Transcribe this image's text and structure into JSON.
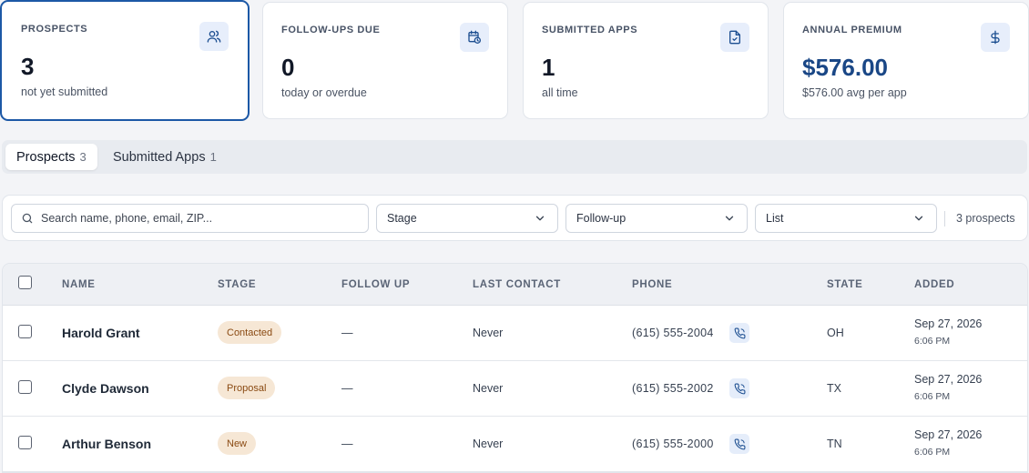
{
  "stats": [
    {
      "label": "PROSPECTS",
      "value": "3",
      "sub": "not yet submitted",
      "icon": "users-icon"
    },
    {
      "label": "FOLLOW-UPS DUE",
      "value": "0",
      "sub": "today or overdue",
      "icon": "calendar-clock-icon"
    },
    {
      "label": "SUBMITTED APPS",
      "value": "1",
      "sub": "all time",
      "icon": "file-check-icon"
    },
    {
      "label": "ANNUAL PREMIUM",
      "value": "$576.00",
      "sub": "$576.00 avg per app",
      "icon": "dollar-icon"
    }
  ],
  "tabs": [
    {
      "label": "Prospects",
      "count": "3"
    },
    {
      "label": "Submitted Apps",
      "count": "1"
    }
  ],
  "filters": {
    "search_placeholder": "Search name, phone, email, ZIP...",
    "stage": "Stage",
    "followup": "Follow-up",
    "list": "List",
    "count_text": "3 prospects"
  },
  "table": {
    "headers": {
      "name": "NAME",
      "stage": "STAGE",
      "follow_up": "FOLLOW UP",
      "last_contact": "LAST CONTACT",
      "phone": "PHONE",
      "state": "STATE",
      "added": "ADDED"
    },
    "rows": [
      {
        "name": "Harold Grant",
        "stage": "Contacted",
        "follow_up": "—",
        "last_contact": "Never",
        "phone": "(615) 555-2004",
        "state": "OH",
        "added_date": "Sep 27, 2026",
        "added_time": "6:06 PM"
      },
      {
        "name": "Clyde Dawson",
        "stage": "Proposal",
        "follow_up": "—",
        "last_contact": "Never",
        "phone": "(615) 555-2002",
        "state": "TX",
        "added_date": "Sep 27, 2026",
        "added_time": "6:06 PM"
      },
      {
        "name": "Arthur Benson",
        "stage": "New",
        "follow_up": "—",
        "last_contact": "Never",
        "phone": "(615) 555-2000",
        "state": "TN",
        "added_date": "Sep 27, 2026",
        "added_time": "6:06 PM"
      }
    ]
  },
  "colors": {
    "accent": "#1c58a6",
    "badge_bg": "#f6e7d5",
    "badge_text": "#8a4a12"
  }
}
